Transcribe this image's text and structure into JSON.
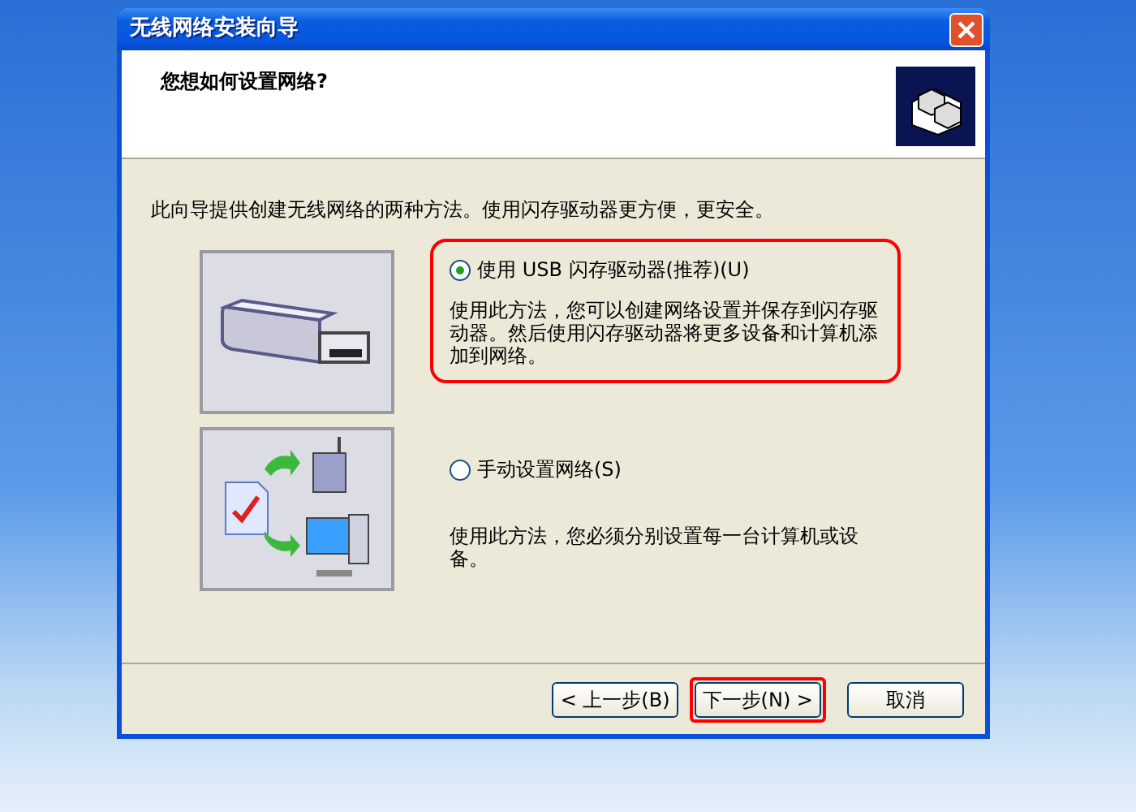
{
  "window": {
    "title": "无线网络安装向导"
  },
  "header": {
    "heading": "您想如何设置网络?"
  },
  "intro": "此向导提供创建无线网络的两种方法。使用闪存驱动器更方便，更安全。",
  "options": [
    {
      "kind": "usb",
      "label": "使用 USB 闪存驱动器(推荐)(U)",
      "description": "使用此方法，您可以创建网络设置并保存到闪存驱动器。然后使用闪存驱动器将更多设备和计算机添加到网络。",
      "selected": true,
      "highlighted": true
    },
    {
      "kind": "manual",
      "label": "手动设置网络(S)",
      "description": "使用此方法，您必须分别设置每一台计算机或设备。",
      "selected": false,
      "highlighted": false
    }
  ],
  "buttons": [
    {
      "label": "< 上一步(B)",
      "highlighted": false
    },
    {
      "label": "下一步(N) >",
      "highlighted": true
    },
    {
      "label": "取消",
      "highlighted": false
    }
  ]
}
